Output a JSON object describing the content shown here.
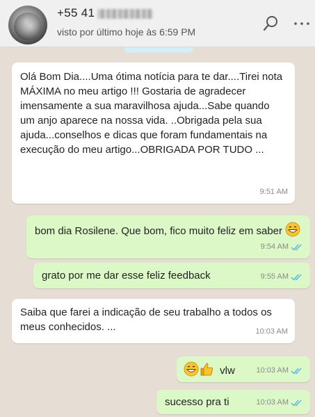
{
  "header": {
    "contact_name": "+55 41",
    "last_seen": "visto por último hoje às 6:59 PM",
    "search_icon": "search-icon",
    "menu_icon": "more-options-icon"
  },
  "colors": {
    "header_bg": "#f0f0f0",
    "chat_bg": "#e6ddd4",
    "incoming_bubble": "#ffffff",
    "outgoing_bubble": "#dcf8c6",
    "read_ticks": "#4fb6ec"
  },
  "messages": [
    {
      "direction": "incoming",
      "text": "Olá Bom Dia....Uma ótima notícia para te dar....Tirei nota MÁXIMA no meu artigo !!! Gostaria de agradecer imensamente a sua maravilhosa ajuda...Sabe quando um anjo aparece na nossa vida. ..Obrigada pela sua ajuda...conselhos e dicas que foram fundamentais na execução do meu artigo...OBRIGADA POR TUDO ...",
      "time": "9:51 AM"
    },
    {
      "direction": "outgoing",
      "text": "bom dia Rosilene. Que bom, fico muito feliz em saber",
      "emoji": "grinning-face-emoji",
      "time": "9:54 AM",
      "status": "read"
    },
    {
      "direction": "outgoing",
      "text": "grato por me dar esse feliz feedback",
      "time": "9:55 AM",
      "status": "read"
    },
    {
      "direction": "incoming",
      "text": "Saiba que farei a indicação de seu trabalho a todos os meus conhecidos. ...",
      "time": "10:03 AM"
    },
    {
      "direction": "outgoing",
      "text": "vlw",
      "emoji": "grinning-face-and-thumbs-up-emoji",
      "time": "10:03 AM",
      "status": "read"
    },
    {
      "direction": "outgoing",
      "text": "sucesso pra ti",
      "time": "10:03 AM",
      "status": "read"
    }
  ]
}
